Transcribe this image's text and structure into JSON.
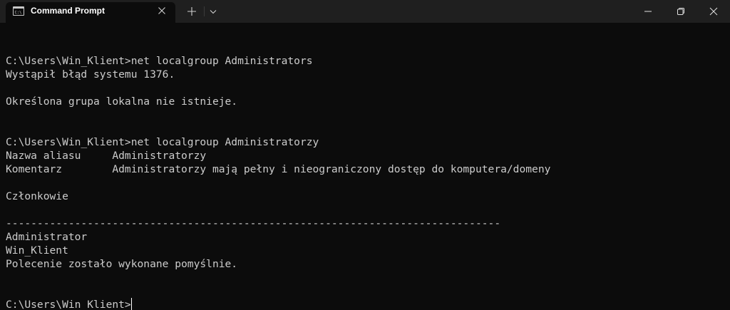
{
  "window": {
    "tab_title": "Command Prompt"
  },
  "icons": {
    "tab": "cmd-icon",
    "close_tab": "close-icon",
    "new_tab": "plus-icon",
    "dropdown": "chevron-down-icon",
    "minimize": "minimize-icon",
    "maximize": "maximize-icon",
    "close_window": "close-icon"
  },
  "colors": {
    "background": "#0c0c0c",
    "titlebar": "#1f1f1f",
    "text": "#cccccc"
  },
  "terminal": {
    "lines": [
      "",
      "C:\\Users\\Win_Klient>net localgroup Administrators",
      "Wystąpił błąd systemu 1376.",
      "",
      "Określona grupa lokalna nie istnieje.",
      "",
      "",
      "C:\\Users\\Win_Klient>net localgroup Administratorzy",
      "Nazwa aliasu     Administratorzy",
      "Komentarz        Administratorzy mają pełny i nieograniczony dostęp do komputera/domeny",
      "",
      "Członkowie",
      "",
      "-------------------------------------------------------------------------------",
      "Administrator",
      "Win_Klient",
      "Polecenie zostało wykonane pomyślnie.",
      "",
      ""
    ],
    "prompt": "C:\\Users\\Win_Klient>"
  }
}
